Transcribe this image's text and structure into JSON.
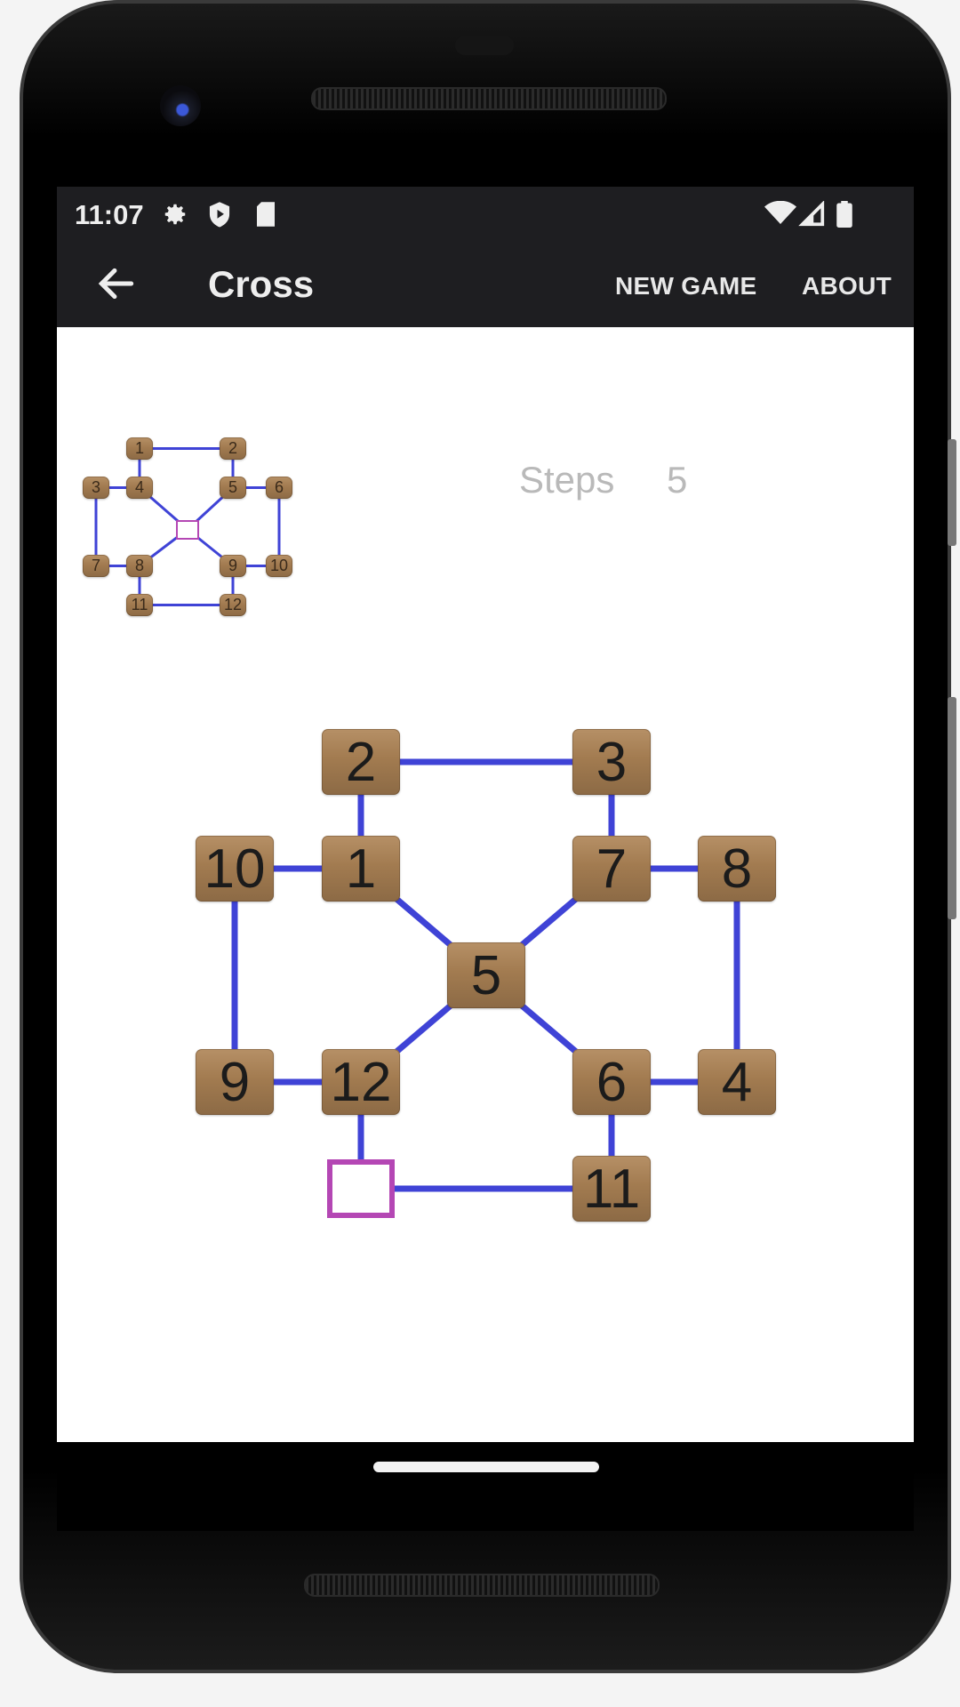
{
  "status_bar": {
    "time": "11:07",
    "left_icons": [
      "gear-icon",
      "shield-play-icon",
      "sd-card-icon"
    ],
    "right_icons": [
      "wifi-icon",
      "cellular-signal-icon",
      "battery-icon"
    ]
  },
  "app_bar": {
    "back_icon": "arrow-left-icon",
    "title": "Cross",
    "actions": [
      {
        "label": "NEW GAME"
      },
      {
        "label": "ABOUT"
      }
    ]
  },
  "game": {
    "steps_label": "Steps",
    "steps_value": "5",
    "colors": {
      "edge": "#3f43d6",
      "empty_marker": "#b447b4",
      "tile_wood": "#a27b50",
      "screen_bg": "#ffffff",
      "bar_bg": "#1e1e21"
    },
    "goal_board": {
      "description": "target arrangement (mini preview)",
      "positions": [
        {
          "slot": "r0c1",
          "value": "1"
        },
        {
          "slot": "r0c3",
          "value": "2"
        },
        {
          "slot": "r1c0",
          "value": "3"
        },
        {
          "slot": "r1c1",
          "value": "4"
        },
        {
          "slot": "r1c3",
          "value": "5"
        },
        {
          "slot": "r1c4",
          "value": "6"
        },
        {
          "slot": "r2c2",
          "value": ""
        },
        {
          "slot": "r3c0",
          "value": "7"
        },
        {
          "slot": "r3c1",
          "value": "8"
        },
        {
          "slot": "r3c3",
          "value": "9"
        },
        {
          "slot": "r3c4",
          "value": "10"
        },
        {
          "slot": "r4c1",
          "value": "11"
        },
        {
          "slot": "r4c3",
          "value": "12"
        }
      ]
    },
    "current_board": {
      "positions": [
        {
          "slot": "r0c1",
          "value": "2"
        },
        {
          "slot": "r0c3",
          "value": "3"
        },
        {
          "slot": "r1c0",
          "value": "10"
        },
        {
          "slot": "r1c1",
          "value": "1"
        },
        {
          "slot": "r1c3",
          "value": "7"
        },
        {
          "slot": "r1c4",
          "value": "8"
        },
        {
          "slot": "r2c2",
          "value": "5"
        },
        {
          "slot": "r3c0",
          "value": "9"
        },
        {
          "slot": "r3c1",
          "value": "12"
        },
        {
          "slot": "r3c3",
          "value": "6"
        },
        {
          "slot": "r3c4",
          "value": "4"
        },
        {
          "slot": "r4c1",
          "value": ""
        },
        {
          "slot": "r4c3",
          "value": "11"
        }
      ]
    },
    "edges": [
      [
        "r0c1",
        "r0c3"
      ],
      [
        "r0c1",
        "r1c1"
      ],
      [
        "r0c3",
        "r1c3"
      ],
      [
        "r1c0",
        "r1c1"
      ],
      [
        "r1c3",
        "r1c4"
      ],
      [
        "r1c0",
        "r3c0"
      ],
      [
        "r1c4",
        "r3c4"
      ],
      [
        "r1c1",
        "r2c2"
      ],
      [
        "r1c3",
        "r2c2"
      ],
      [
        "r3c1",
        "r2c2"
      ],
      [
        "r3c3",
        "r2c2"
      ],
      [
        "r3c0",
        "r3c1"
      ],
      [
        "r3c3",
        "r3c4"
      ],
      [
        "r3c1",
        "r4c1"
      ],
      [
        "r3c3",
        "r4c3"
      ],
      [
        "r4c1",
        "r4c3"
      ]
    ]
  }
}
